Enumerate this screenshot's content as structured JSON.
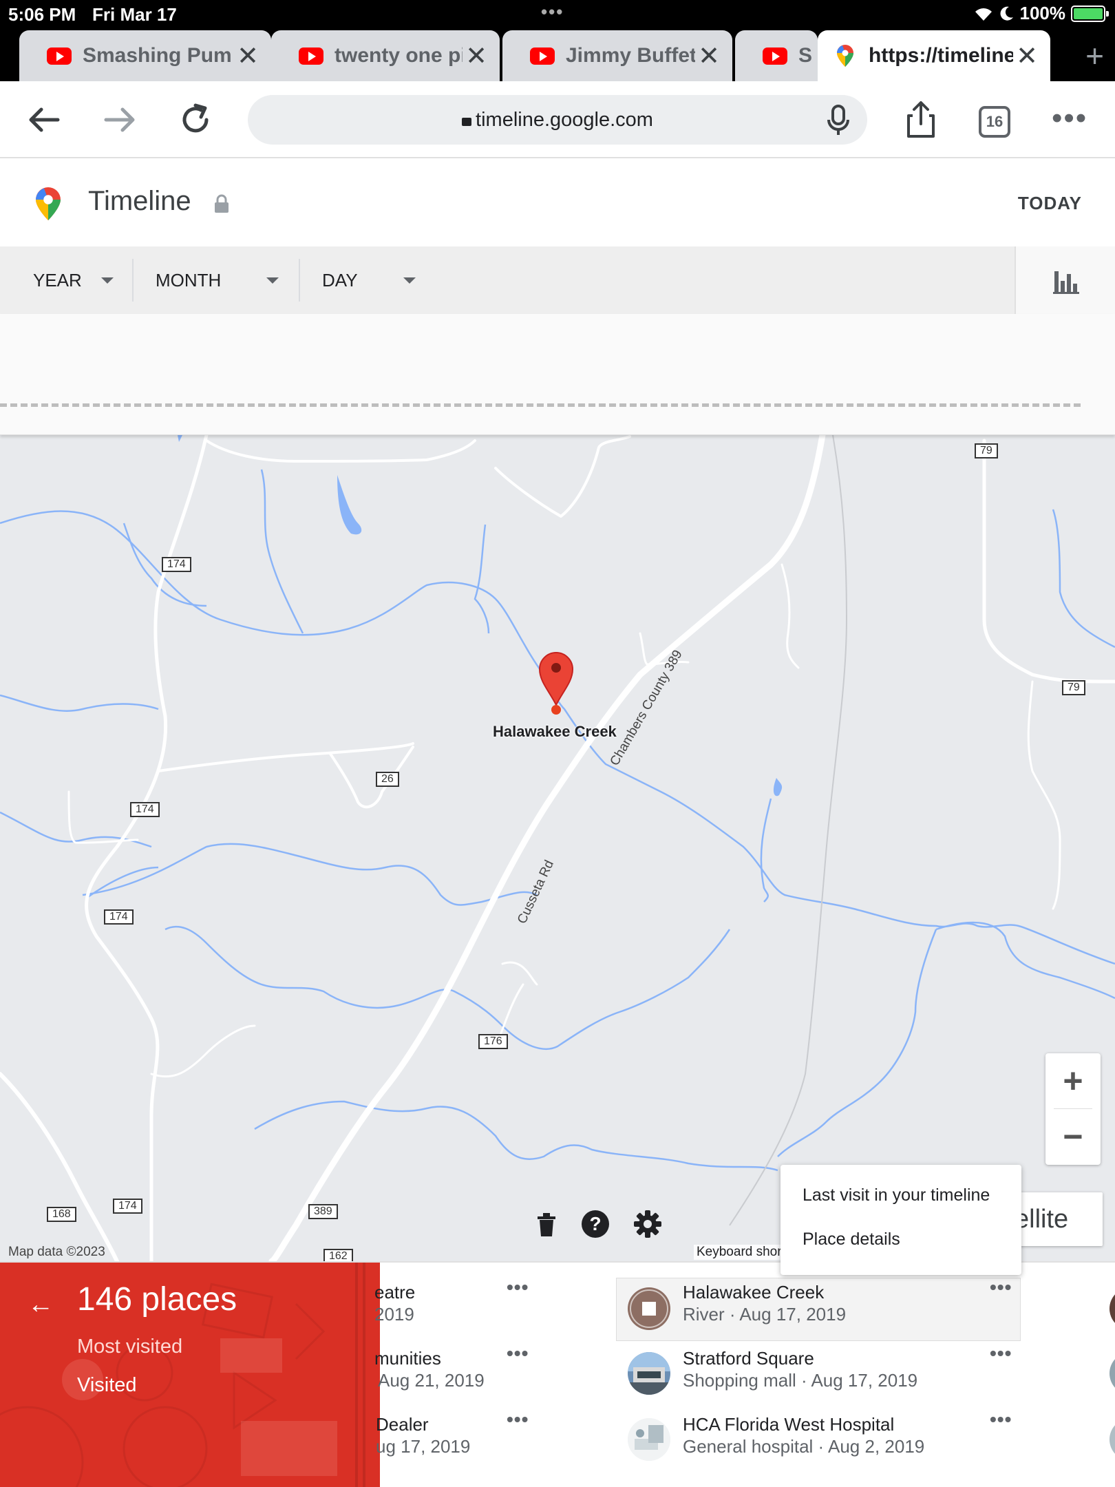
{
  "status_bar": {
    "time": "5:06 PM",
    "date": "Fri Mar 17",
    "dots": "•••",
    "battery": "100%"
  },
  "tabs": [
    {
      "label": "Smashing Pum",
      "icon": "youtube-icon"
    },
    {
      "label": "twenty one pilo",
      "icon": "youtube-icon"
    },
    {
      "label": "Jimmy Buffett",
      "icon": "youtube-icon"
    },
    {
      "label": "S",
      "icon": "youtube-icon"
    },
    {
      "label": "https://timeline",
      "icon": "google-maps-pin-icon",
      "active": true
    }
  ],
  "toolbar": {
    "url": "timeline.google.com",
    "tab_count": "16"
  },
  "header": {
    "title": "Timeline",
    "today": "TODAY"
  },
  "filters": {
    "year": "YEAR",
    "month": "MONTH",
    "day": "DAY"
  },
  "map": {
    "pin_label": "Halawakee Creek",
    "road_labels": {
      "chambers": "Chambers County 389",
      "cusseta": "Cusseta Rd"
    },
    "shields": {
      "s79a": "79",
      "s79b": "79",
      "s174a": "174",
      "s174b": "174",
      "s174c": "174",
      "s174d": "174",
      "s26": "26",
      "s176": "176",
      "s168": "168",
      "s389": "389",
      "s162": "162"
    },
    "attribution": "Map data ©2023",
    "keyboard": "Keyboard shor",
    "satellite": "ellite",
    "zoom_in": "+",
    "zoom_out": "−"
  },
  "context_menu": {
    "item1": "Last visit in your timeline",
    "item2": "Place details"
  },
  "summary": {
    "count": "146 places",
    "most_visited": "Most visited",
    "visited": "Visited",
    "back": "←"
  },
  "places_left": [
    {
      "name": "eatre",
      "meta": "2019"
    },
    {
      "name": "munities",
      "meta": "Aug 21, 2019"
    },
    {
      "name": "Dealer",
      "meta": "ug 17, 2019"
    }
  ],
  "places_right": [
    {
      "name": "Halawakee Creek",
      "meta": "River · Aug 17, 2019"
    },
    {
      "name": "Stratford Square",
      "meta": "Shopping mall · Aug 17, 2019"
    },
    {
      "name": "HCA Florida West Hospital",
      "meta": "General hospital · Aug 2, 2019"
    }
  ],
  "more_label": "•••",
  "colors": {
    "accent_red": "#d93025",
    "map_bg": "#e8eaed",
    "water": "#8ab4f8",
    "road": "#ffffff"
  }
}
